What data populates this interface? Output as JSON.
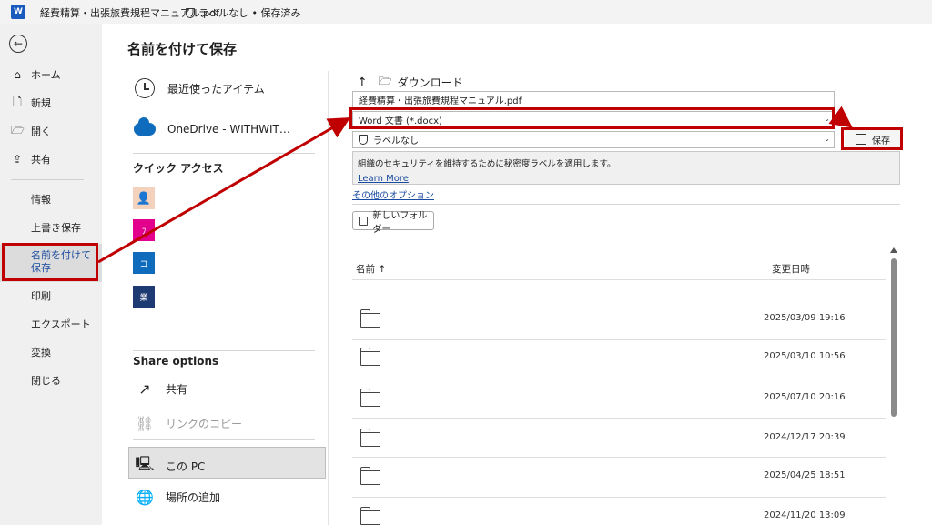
{
  "titlebar": {
    "app_icon": "word-logo",
    "app_icon_text": "W",
    "file_name": "経費精算・出張旅費規程マニュアル.pdf",
    "label_status": "ラベルなし • 保存済み"
  },
  "rail": {
    "back_icon": "back-arrow-icon",
    "items": [
      {
        "label": "ホーム",
        "icon": "home-icon"
      },
      {
        "label": "新規",
        "icon": "new-document-icon"
      },
      {
        "label": "開く",
        "icon": "folder-open-icon"
      },
      {
        "label": "共有",
        "icon": "share-icon"
      }
    ],
    "sub_items": [
      {
        "label": "情報"
      },
      {
        "label": "上書き保存"
      },
      {
        "label": "名前を付けて保存",
        "active": true
      },
      {
        "label": "印刷"
      },
      {
        "label": "エクスポート"
      },
      {
        "label": "変換"
      },
      {
        "label": "閉じる"
      }
    ]
  },
  "main": {
    "title": "名前を付けて保存",
    "locations": [
      {
        "label": "最近使ったアイテム",
        "icon": "clock-icon"
      },
      {
        "label": "OneDrive - WITHWIT…",
        "icon": "onedrive-cloud-icon"
      }
    ],
    "quick_access_label": "クイック アクセス",
    "quick_access": [
      {
        "glyph": "👤",
        "color": "#f3d2bd",
        "icon": "avatar-icon"
      },
      {
        "glyph": "ﾌ",
        "color": "#e3008c",
        "icon": "pink-folder-icon"
      },
      {
        "glyph": "コ",
        "color": "#0f6cbd",
        "icon": "blue-folder-icon"
      },
      {
        "glyph": "業",
        "color": "#1e3a73",
        "icon": "navy-folder-icon"
      }
    ],
    "share_options_label": "Share options",
    "share_items": [
      {
        "label": "共有",
        "icon": "share-icon"
      },
      {
        "label": "リンクのコピー",
        "icon": "link-icon"
      }
    ],
    "bottom_items": [
      {
        "label": "この PC",
        "icon": "pc-icon"
      },
      {
        "label": "場所の追加",
        "icon": "add-location-icon"
      }
    ]
  },
  "save_pane": {
    "up_icon": "up-arrow-icon",
    "location": "ダウンロード",
    "file_name_value": "経費精算・出張旅費規程マニュアル.pdf",
    "file_type_value": "Word 文書 (*.docx)",
    "sensitivity_value": "ラベルなし",
    "save_label": "保存",
    "info_text": "組織のセキュリティを維持するために秘密度ラベルを適用します。",
    "info_link": "Learn More",
    "more_options": "その他のオプション",
    "new_folder": "新しいフォルダー",
    "col_name": "名前 ↑",
    "col_modified": "変更日時",
    "rows": [
      {
        "date": "2025/03/09 19:16"
      },
      {
        "date": "2025/03/10 10:56"
      },
      {
        "date": "2025/07/10 20:16"
      },
      {
        "date": "2024/12/17 20:39"
      },
      {
        "date": "2025/04/25 18:51"
      },
      {
        "date": "2024/11/20 13:09"
      }
    ]
  },
  "annotations": {
    "color": "#c00000"
  }
}
